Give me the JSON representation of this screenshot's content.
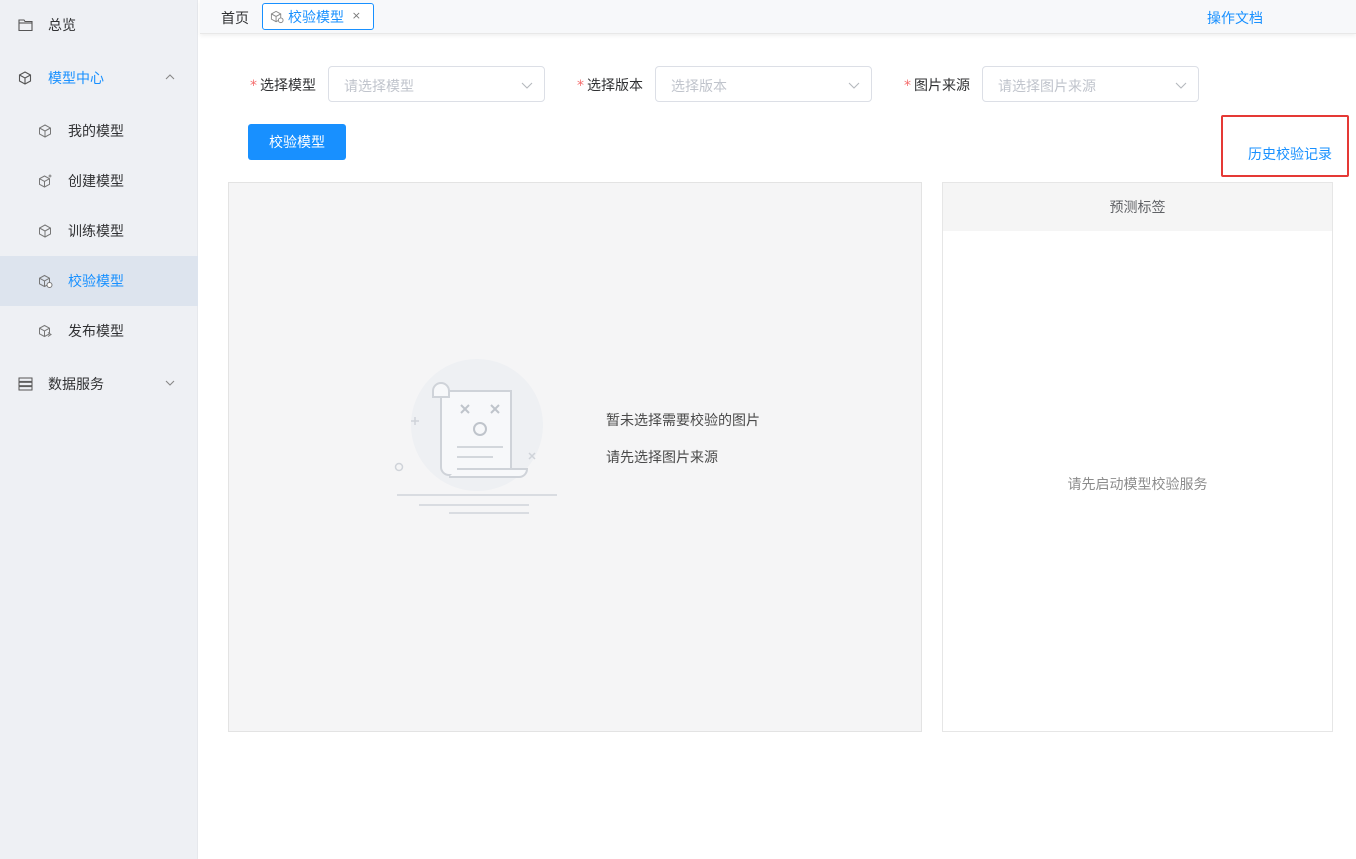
{
  "sidebar": {
    "overview": {
      "label": "总览",
      "icon": "folder-icon"
    },
    "model_center": {
      "label": "模型中心",
      "icon": "cube-icon",
      "expanded": true
    },
    "sub_items": [
      {
        "label": "我的模型",
        "icon": "cube-icon"
      },
      {
        "label": "创建模型",
        "icon": "cube-plus-icon"
      },
      {
        "label": "训练模型",
        "icon": "cube-icon"
      },
      {
        "label": "校验模型",
        "icon": "cube-check-icon",
        "active": true
      },
      {
        "label": "发布模型",
        "icon": "cube-share-icon"
      }
    ],
    "data_service": {
      "label": "数据服务",
      "icon": "list-icon",
      "expanded": false
    }
  },
  "header": {
    "home": "首页",
    "active_tab": "校验模型",
    "tab_close": "×",
    "doc_link": "操作文档"
  },
  "form": {
    "model": {
      "label": "选择模型",
      "placeholder": "请选择模型"
    },
    "version": {
      "label": "选择版本",
      "placeholder": "选择版本"
    },
    "source": {
      "label": "图片来源",
      "placeholder": "请选择图片来源"
    },
    "required_mark": "*"
  },
  "actions": {
    "verify_button": "校验模型",
    "history_link": "历史校验记录"
  },
  "preview": {
    "empty_line1": "暂未选择需要校验的图片",
    "empty_line2": "请先选择图片来源"
  },
  "labels_panel": {
    "title": "预测标签",
    "empty": "请先启动模型校验服务"
  },
  "colors": {
    "primary": "#1890ff",
    "highlight_border": "#e53935",
    "required": "#f56c6c"
  }
}
